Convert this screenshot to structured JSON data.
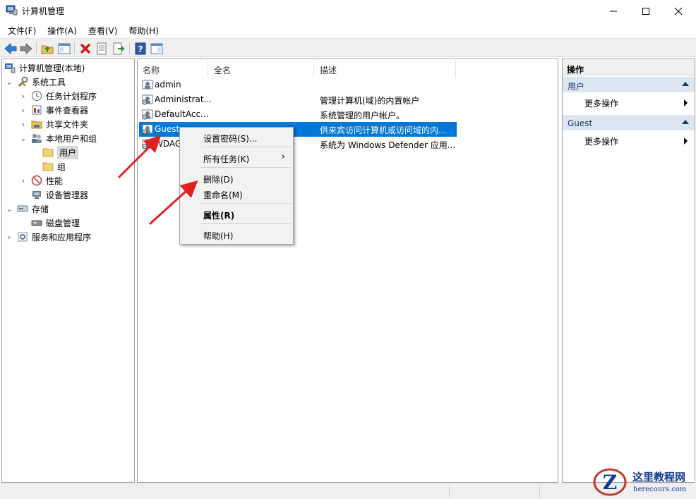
{
  "window": {
    "title": "计算机管理"
  },
  "menubar": {
    "items": [
      "文件(F)",
      "操作(A)",
      "查看(V)",
      "帮助(H)"
    ]
  },
  "tree": {
    "root": "计算机管理(本地)",
    "system_tools": "系统工具",
    "task_scheduler": "任务计划程序",
    "event_viewer": "事件查看器",
    "shared_folders": "共享文件夹",
    "local_users_groups": "本地用户和组",
    "users": "用户",
    "groups": "组",
    "performance": "性能",
    "device_manager": "设备管理器",
    "storage": "存储",
    "disk_management": "磁盘管理",
    "services_apps": "服务和应用程序"
  },
  "list": {
    "columns": [
      "名称",
      "全名",
      "描述"
    ],
    "rows": [
      {
        "name": "admin",
        "full_name": "",
        "description": ""
      },
      {
        "name": "Administrat...",
        "full_name": "",
        "description": "管理计算机(域)的内置帐户"
      },
      {
        "name": "DefaultAcc...",
        "full_name": "",
        "description": "系统管理的用户帐户。"
      },
      {
        "name": "Guest",
        "full_name": "",
        "description": "供来宾访问计算机或访问域的内..."
      },
      {
        "name": "WDAG",
        "full_name": "",
        "description": "系统为 Windows Defender 应用..."
      }
    ],
    "selected_row": "Guest"
  },
  "context_menu": {
    "set_password": "设置密码(S)...",
    "all_tasks": "所有任务(K)",
    "delete": "删除(D)",
    "rename": "重命名(M)",
    "properties": "属性(R)",
    "help": "帮助(H)"
  },
  "actions": {
    "header": "操作",
    "sections": [
      {
        "title": "用户",
        "item": "更多操作"
      },
      {
        "title": "Guest",
        "item": "更多操作"
      }
    ]
  },
  "watermark": {
    "title": "这里教程网",
    "url": "herecours.com"
  },
  "colors": {
    "selection": "#0078d7",
    "annotation_arrow": "#e02020",
    "section_header": "#dce6f2"
  }
}
